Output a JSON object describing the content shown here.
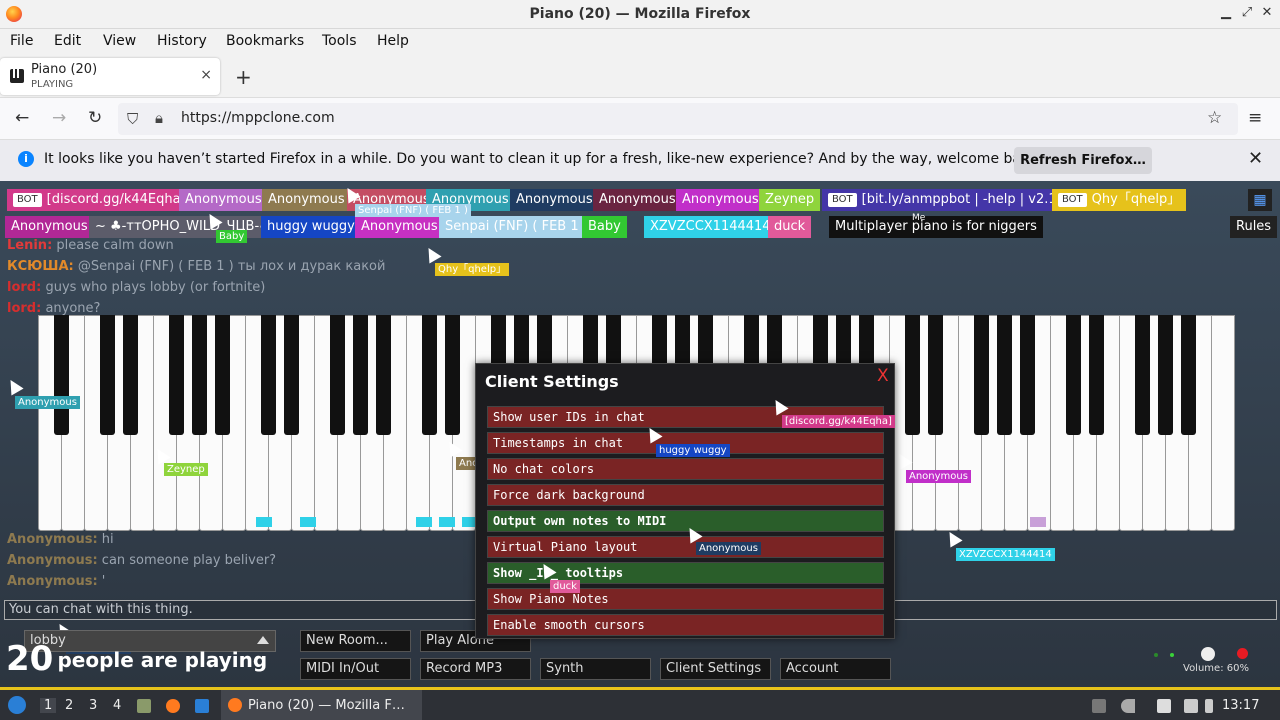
{
  "window": {
    "title": "Piano (20) — Mozilla Firefox"
  },
  "menu": [
    "File",
    "Edit",
    "View",
    "History",
    "Bookmarks",
    "Tools",
    "Help"
  ],
  "tab": {
    "title": "Piano (20)",
    "subtitle": "PLAYING",
    "close": "×",
    "new_tab": "+"
  },
  "nav": {
    "url": "https://mppclone.com"
  },
  "notification": {
    "message": "It looks like you haven’t started Firefox in a while. Do you want to clean it up for a fresh, like-new experience? And by the way, welcome back!",
    "button": "Refresh Firefox…",
    "close": "✕"
  },
  "users_row1": [
    {
      "name": "[discord.gg/k44Eqha]",
      "bot": true,
      "color": "#d23a8a"
    },
    {
      "name": "Anonymous",
      "color": "#b469c7"
    },
    {
      "name": "Anonymous",
      "color": "#8e7a4f"
    },
    {
      "name": "Anonymous",
      "color": "#c44d63"
    },
    {
      "name": "Anonymous",
      "color": "#2fa0b0"
    },
    {
      "name": "Anonymous",
      "color": "#1f3c62"
    },
    {
      "name": "Anonymous",
      "color": "#6a2441"
    },
    {
      "name": "Anonymous",
      "color": "#c12fc9"
    },
    {
      "name": "Zeynep",
      "color": "#8fd43c"
    },
    {
      "name": "[bit.ly/anmppbot | -help | v2.1]",
      "bot": true,
      "color": "#4436a8"
    },
    {
      "name": "Qhy「qhelp」",
      "bot": true,
      "color": "#e6c21b"
    }
  ],
  "users_row2": [
    {
      "name": "Anonymous",
      "color": "#b12896"
    },
    {
      "name": "~ ♣-ттОРНО_WILD_ЧЦВ-♣ ~",
      "color": "#5c5c6a"
    },
    {
      "name": "huggy wuggy",
      "color": "#1546c4"
    },
    {
      "name": "Anonymous",
      "color": "#c730c2"
    },
    {
      "name": "Senpai (FNF) ( FEB 1 )",
      "color": "#a8d4ec"
    },
    {
      "name": "Baby",
      "color": "#32c832"
    },
    {
      "name": "XZVZCCX1144414",
      "color": "#2fd1e8"
    },
    {
      "name": "duck",
      "color": "#e15a9a"
    },
    {
      "name": "Multiplayer piano is for niggers",
      "color": "#111111"
    }
  ],
  "rules": "Rules",
  "me_label": "Me",
  "chat": [
    {
      "name": "Lenin:",
      "text": "please calm down",
      "color": "#e23a3a"
    },
    {
      "name": "КСЮША:",
      "text": "@Senpai (FNF) ( FEB 1 ) ты лох и дурак какой",
      "color": "#e28a2a"
    },
    {
      "name": "lord:",
      "text": "guys who plays lobby (or fortnite)",
      "color": "#d62e2e"
    },
    {
      "name": "lord:",
      "text": "anyone?",
      "color": "#d62e2e"
    },
    {
      "name": "Anonymous:",
      "text": "hi",
      "color": "#8e7a4f"
    },
    {
      "name": "Anonymous:",
      "text": "can someone play beliver?",
      "color": "#8e7a4f"
    },
    {
      "name": "Anonymous:",
      "text": "'",
      "color": "#8e7a4f"
    }
  ],
  "chat_placeholder": "You can chat with this thing.",
  "cursors": [
    {
      "label": "Senpai (FNF) ( FEB 1 )",
      "color": "#a8d4ec"
    },
    {
      "label": "Baby",
      "color": "#32c832"
    },
    {
      "label": "Qhy「qhelp」",
      "color": "#e6c21b"
    },
    {
      "label": "Anonymous",
      "color": "#2fa0b0"
    },
    {
      "label": "Zeynep",
      "color": "#8fd43c"
    },
    {
      "label": "Anonymous",
      "color": "#8e7a4f"
    },
    {
      "label": "huggy wuggy",
      "color": "#1546c4"
    },
    {
      "label": "[discord.gg/k44Eqha]",
      "color": "#d23a8a"
    },
    {
      "label": "Anonymous",
      "color": "#c12fc9"
    },
    {
      "label": "Anonymous",
      "color": "#1f3c62"
    },
    {
      "label": "duck",
      "color": "#e15a9a"
    },
    {
      "label": "XZVZCCX1144414",
      "color": "#2fd1e8"
    },
    {
      "label": "Anonymous",
      "color": "#1f3c62"
    }
  ],
  "modal": {
    "title": "Client Settings",
    "close": "X",
    "options": [
      {
        "label": "Show user IDs in chat",
        "on": false
      },
      {
        "label": "Timestamps in chat",
        "on": false
      },
      {
        "label": "No chat colors",
        "on": false
      },
      {
        "label": "Force dark background",
        "on": false
      },
      {
        "label": "Output own notes to MIDI",
        "on": true
      },
      {
        "label": "Virtual Piano layout",
        "on": false
      },
      {
        "label": "Show _ID_ tooltips",
        "on": true
      },
      {
        "label": "Show Piano Notes",
        "on": false
      },
      {
        "label": "Enable smooth cursors",
        "on": false
      }
    ]
  },
  "room": "lobby",
  "players": {
    "count": "20",
    "text": "people are playing"
  },
  "buttons": {
    "new_room": "New Room...",
    "play_alone": "Play Alone",
    "midi": "MIDI In/Out",
    "record": "Record MP3",
    "synth": "Synth",
    "client_settings": "Client Settings",
    "account": "Account"
  },
  "volume": "Volume: 60%",
  "taskbar": {
    "workspaces": [
      "1",
      "2",
      "3",
      "4"
    ],
    "window": "Piano (20) — Mozilla F…",
    "clock": "13:17"
  }
}
